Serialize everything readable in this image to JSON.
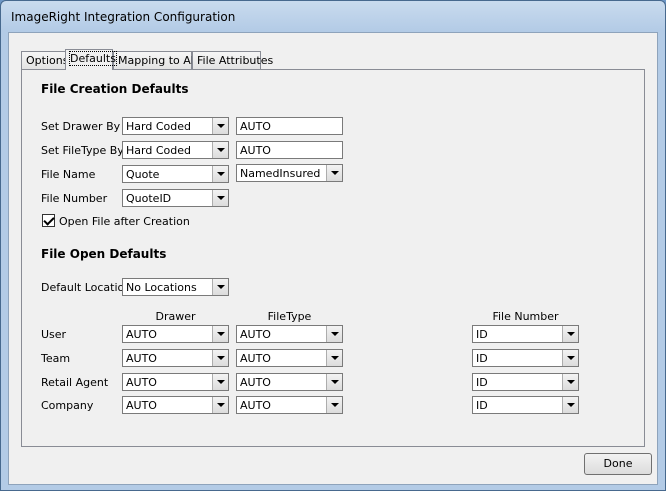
{
  "window": {
    "title": "ImageRight Integration Configuration"
  },
  "tabs": [
    {
      "label": "Options",
      "active": false
    },
    {
      "label": "Defaults",
      "active": true
    },
    {
      "label": "Mapping to AIM",
      "active": false
    },
    {
      "label": "File Attributes",
      "active": false
    }
  ],
  "creation": {
    "title": "File Creation Defaults",
    "drawer": {
      "label": "Set Drawer By",
      "mode": "Hard Coded",
      "value": "AUTO"
    },
    "filetype": {
      "label": "Set FileType By",
      "mode": "Hard Coded",
      "value": "AUTO"
    },
    "filename": {
      "label": "File Name",
      "value": "Quote",
      "field": "NamedInsured"
    },
    "filenumber": {
      "label": "File Number",
      "value": "QuoteID"
    },
    "open_after": {
      "label": "Open File after Creation",
      "checked": true
    }
  },
  "open": {
    "title": "File Open Defaults",
    "location": {
      "label": "Default Location",
      "value": "No Locations"
    },
    "columns": {
      "drawer": "Drawer",
      "filetype": "FileType",
      "filenumber": "File Number"
    },
    "rows": [
      {
        "label": "User",
        "drawer": "AUTO",
        "filetype": "AUTO",
        "filenumber": "ID"
      },
      {
        "label": "Team",
        "drawer": "AUTO",
        "filetype": "AUTO",
        "filenumber": "ID"
      },
      {
        "label": "Retail Agent",
        "drawer": "AUTO",
        "filetype": "AUTO",
        "filenumber": "ID"
      },
      {
        "label": "Company",
        "drawer": "AUTO",
        "filetype": "AUTO",
        "filenumber": "ID"
      }
    ]
  },
  "buttons": {
    "done": "Done"
  }
}
